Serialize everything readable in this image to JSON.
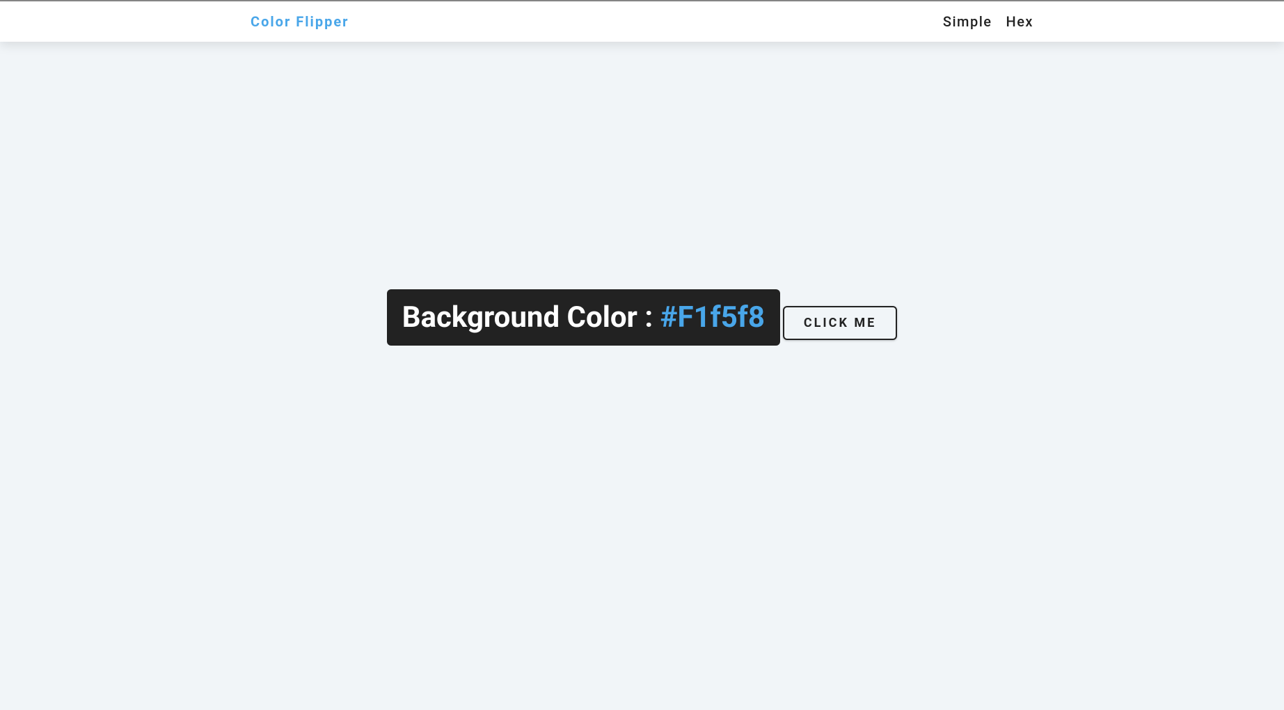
{
  "nav": {
    "brand": "Color Flipper",
    "links": [
      {
        "label": "Simple"
      },
      {
        "label": "Hex"
      }
    ]
  },
  "main": {
    "label_prefix": "Background Color : ",
    "color_value": "#F1f5f8",
    "button_label": "click me"
  },
  "colors": {
    "background": "#f1f5f8",
    "accent": "#49a6e9",
    "dark": "#222222"
  }
}
